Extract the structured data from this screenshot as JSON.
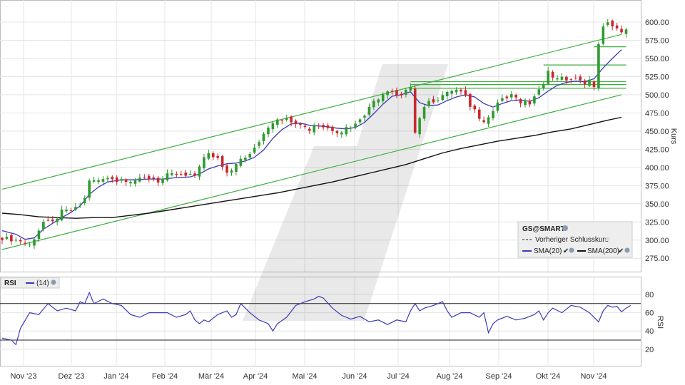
{
  "chart_data": {
    "type": "candlestick",
    "price_panel": {
      "ylabel": "Kurs",
      "ylim": [
        255,
        615
      ],
      "yticks": [
        "600.00",
        "575.00",
        "550.00",
        "525.00",
        "500.00",
        "475.00",
        "450.00",
        "425.00",
        "400.00",
        "375.00",
        "350.00",
        "325.00",
        "300.00",
        "275.00"
      ],
      "ytick_values": [
        600,
        575,
        550,
        525,
        500,
        475,
        450,
        425,
        400,
        375,
        350,
        325,
        300,
        275
      ],
      "x_ticks": [
        "Nov '23",
        "Dez '23",
        "Jan '24",
        "Feb '24",
        "Mär '24",
        "Apr '24",
        "Mai '24",
        "Jun '24",
        "Jul '24",
        "Aug '24",
        "Sep '24",
        "Okt '24",
        "Nov '24"
      ],
      "legend": {
        "symbol": "GS@SMART",
        "items": [
          "Vorheriger Schlusskurs",
          "SMA(20)",
          "SMA(200)"
        ]
      },
      "series": {
        "close_path": [
          [
            0,
            303
          ],
          [
            4,
            299
          ],
          [
            6,
            293
          ],
          [
            7,
            303
          ],
          [
            9,
            325
          ],
          [
            11,
            324
          ],
          [
            13,
            339
          ],
          [
            15,
            341
          ],
          [
            16,
            343
          ],
          [
            17,
            349
          ],
          [
            18,
            357
          ],
          [
            19,
            383
          ],
          [
            20,
            381
          ],
          [
            22,
            383
          ],
          [
            23,
            386
          ],
          [
            24,
            386
          ],
          [
            25,
            381
          ],
          [
            26,
            384
          ],
          [
            28,
            382
          ],
          [
            30,
            383
          ],
          [
            31,
            385
          ],
          [
            33,
            385
          ],
          [
            34,
            381
          ],
          [
            35,
            384
          ],
          [
            36,
            389
          ],
          [
            38,
            390
          ],
          [
            40,
            388
          ],
          [
            42,
            389
          ],
          [
            43,
            403
          ],
          [
            44,
            413
          ],
          [
            45,
            418
          ],
          [
            47,
            413
          ],
          [
            48,
            403
          ],
          [
            49,
            395
          ],
          [
            50,
            397
          ],
          [
            51,
            407
          ],
          [
            53,
            413
          ],
          [
            55,
            425
          ],
          [
            56,
            435
          ],
          [
            57,
            448
          ],
          [
            58,
            456
          ],
          [
            59,
            463
          ],
          [
            60,
            468
          ],
          [
            61,
            467
          ],
          [
            63,
            465
          ],
          [
            64,
            462
          ],
          [
            65,
            461
          ],
          [
            66,
            455
          ],
          [
            67,
            452
          ],
          [
            68,
            459
          ],
          [
            69,
            458
          ],
          [
            70,
            456
          ],
          [
            72,
            452
          ],
          [
            73,
            450
          ],
          [
            74,
            450
          ],
          [
            75,
            455
          ],
          [
            77,
            459
          ],
          [
            78,
            468
          ],
          [
            79,
            474
          ],
          [
            80,
            482
          ],
          [
            81,
            492
          ],
          [
            82,
            496
          ],
          [
            83,
            502
          ],
          [
            84,
            507
          ],
          [
            85,
            505
          ],
          [
            86,
            499
          ],
          [
            87,
            500
          ],
          [
            88,
            507
          ],
          [
            89,
            508
          ],
          [
            90,
            446
          ],
          [
            91,
            470
          ],
          [
            92,
            483
          ],
          [
            93,
            490
          ],
          [
            94,
            488
          ],
          [
            95,
            491
          ],
          [
            96,
            497
          ],
          [
            97,
            506
          ],
          [
            98,
            508
          ],
          [
            100,
            506
          ],
          [
            101,
            496
          ],
          [
            102,
            486
          ],
          [
            103,
            482
          ],
          [
            104,
            467
          ],
          [
            105,
            460
          ],
          [
            106,
            470
          ],
          [
            107,
            477
          ],
          [
            108,
            488
          ],
          [
            110,
            497
          ],
          [
            111,
            500
          ],
          [
            112,
            499
          ],
          [
            113,
            491
          ],
          [
            114,
            492
          ],
          [
            115,
            487
          ],
          [
            116,
            498
          ],
          [
            117,
            505
          ],
          [
            118,
            515
          ],
          [
            119,
            530
          ],
          [
            120,
            525
          ],
          [
            121,
            521
          ],
          [
            122,
            522
          ],
          [
            123,
            522
          ],
          [
            124,
            524
          ],
          [
            125,
            522
          ],
          [
            126,
            521
          ],
          [
            127,
            516
          ],
          [
            128,
            518
          ],
          [
            129,
            512
          ],
          [
            130,
            570
          ],
          [
            131,
            592
          ],
          [
            132,
            598
          ],
          [
            133,
            597
          ],
          [
            134,
            591
          ],
          [
            135,
            584
          ],
          [
            136,
            592
          ]
        ],
        "sma20_path": [
          [
            0,
            313
          ],
          [
            3,
            308
          ],
          [
            5,
            301
          ],
          [
            7,
            303
          ],
          [
            9,
            315
          ],
          [
            11,
            323
          ],
          [
            13,
            331
          ],
          [
            15,
            338
          ],
          [
            17,
            347
          ],
          [
            19,
            363
          ],
          [
            21,
            373
          ],
          [
            23,
            380
          ],
          [
            26,
            383
          ],
          [
            29,
            383
          ],
          [
            32,
            384
          ],
          [
            35,
            384
          ],
          [
            38,
            386
          ],
          [
            41,
            387
          ],
          [
            43,
            391
          ],
          [
            45,
            398
          ],
          [
            47,
            402
          ],
          [
            49,
            405
          ],
          [
            51,
            406
          ],
          [
            53,
            409
          ],
          [
            55,
            414
          ],
          [
            57,
            424
          ],
          [
            59,
            440
          ],
          [
            61,
            452
          ],
          [
            63,
            460
          ],
          [
            65,
            461
          ],
          [
            67,
            458
          ],
          [
            69,
            457
          ],
          [
            71,
            456
          ],
          [
            73,
            454
          ],
          [
            75,
            453
          ],
          [
            77,
            455
          ],
          [
            79,
            462
          ],
          [
            81,
            474
          ],
          [
            83,
            487
          ],
          [
            85,
            498
          ],
          [
            87,
            500
          ],
          [
            89,
            504
          ],
          [
            91,
            489
          ],
          [
            93,
            485
          ],
          [
            95,
            486
          ],
          [
            97,
            492
          ],
          [
            99,
            497
          ],
          [
            101,
            500
          ],
          [
            103,
            497
          ],
          [
            105,
            488
          ],
          [
            107,
            483
          ],
          [
            109,
            488
          ],
          [
            111,
            492
          ],
          [
            113,
            493
          ],
          [
            115,
            491
          ],
          [
            117,
            496
          ],
          [
            119,
            505
          ],
          [
            121,
            513
          ],
          [
            123,
            517
          ],
          [
            125,
            519
          ],
          [
            127,
            518
          ],
          [
            129,
            522
          ],
          [
            131,
            537
          ],
          [
            133,
            550
          ],
          [
            135,
            562
          ]
        ],
        "sma200_path": [
          [
            0,
            337
          ],
          [
            4,
            335
          ],
          [
            8,
            332
          ],
          [
            12,
            331
          ],
          [
            16,
            330
          ],
          [
            20,
            331
          ],
          [
            24,
            331
          ],
          [
            28,
            334
          ],
          [
            32,
            337
          ],
          [
            36,
            341
          ],
          [
            40,
            345
          ],
          [
            44,
            349
          ],
          [
            48,
            353
          ],
          [
            52,
            357
          ],
          [
            56,
            361
          ],
          [
            60,
            365
          ],
          [
            64,
            370
          ],
          [
            68,
            375
          ],
          [
            72,
            380
          ],
          [
            76,
            386
          ],
          [
            80,
            392
          ],
          [
            84,
            398
          ],
          [
            88,
            404
          ],
          [
            92,
            412
          ],
          [
            96,
            420
          ],
          [
            100,
            426
          ],
          [
            104,
            431
          ],
          [
            108,
            436
          ],
          [
            112,
            440
          ],
          [
            116,
            444
          ],
          [
            120,
            449
          ],
          [
            124,
            453
          ],
          [
            128,
            459
          ],
          [
            132,
            465
          ],
          [
            135,
            469
          ]
        ],
        "channel_upper": [
          [
            0,
            370
          ],
          [
            135,
            583
          ]
        ],
        "channel_mid": [
          [
            0,
            287
          ],
          [
            135,
            500
          ]
        ],
        "resistance_lines": [
          {
            "from": 89,
            "to": 136,
            "y": 514
          },
          {
            "from": 89,
            "to": 136,
            "y": 518
          },
          {
            "from": 89,
            "to": 136,
            "y": 509
          },
          {
            "from": 118,
            "to": 136,
            "y": 541
          },
          {
            "from": 129,
            "to": 136,
            "y": 566
          }
        ]
      }
    },
    "rsi_panel": {
      "label": "RSI",
      "period_label": "(14)",
      "ylabel": "RSI",
      "ylim": [
        8,
        88
      ],
      "yticks": [
        "80",
        "60",
        "40",
        "20"
      ],
      "ytick_values": [
        80,
        60,
        40,
        20
      ],
      "levels": [
        70,
        30
      ],
      "rsi_path": [
        [
          0,
          32
        ],
        [
          2,
          30
        ],
        [
          3,
          25
        ],
        [
          4,
          43
        ],
        [
          6,
          60
        ],
        [
          8,
          58
        ],
        [
          10,
          70
        ],
        [
          12,
          62
        ],
        [
          14,
          65
        ],
        [
          16,
          62
        ],
        [
          17,
          72
        ],
        [
          18,
          70
        ],
        [
          19,
          82
        ],
        [
          20,
          70
        ],
        [
          22,
          75
        ],
        [
          24,
          70
        ],
        [
          26,
          68
        ],
        [
          28,
          58
        ],
        [
          30,
          55
        ],
        [
          32,
          60
        ],
        [
          34,
          60
        ],
        [
          36,
          60
        ],
        [
          38,
          55
        ],
        [
          40,
          58
        ],
        [
          41,
          62
        ],
        [
          42,
          52
        ],
        [
          43,
          48
        ],
        [
          44,
          52
        ],
        [
          45,
          50
        ],
        [
          47,
          58
        ],
        [
          49,
          62
        ],
        [
          50,
          55
        ],
        [
          51,
          58
        ],
        [
          52,
          70
        ],
        [
          53,
          65
        ],
        [
          54,
          60
        ],
        [
          56,
          52
        ],
        [
          58,
          48
        ],
        [
          59,
          40
        ],
        [
          60,
          48
        ],
        [
          62,
          55
        ],
        [
          64,
          68
        ],
        [
          66,
          72
        ],
        [
          68,
          75
        ],
        [
          69,
          78
        ],
        [
          70,
          76
        ],
        [
          72,
          65
        ],
        [
          74,
          57
        ],
        [
          76,
          53
        ],
        [
          78,
          56
        ],
        [
          80,
          50
        ],
        [
          82,
          52
        ],
        [
          84,
          47
        ],
        [
          86,
          52
        ],
        [
          88,
          50
        ],
        [
          89,
          62
        ],
        [
          90,
          70
        ],
        [
          91,
          62
        ],
        [
          92,
          65
        ],
        [
          94,
          68
        ],
        [
          96,
          72
        ],
        [
          97,
          62
        ],
        [
          98,
          55
        ],
        [
          100,
          60
        ],
        [
          102,
          60
        ],
        [
          104,
          55
        ],
        [
          105,
          60
        ],
        [
          106,
          38
        ],
        [
          107,
          48
        ],
        [
          108,
          52
        ],
        [
          110,
          56
        ],
        [
          112,
          52
        ],
        [
          114,
          54
        ],
        [
          116,
          58
        ],
        [
          117,
          62
        ],
        [
          118,
          52
        ],
        [
          119,
          60
        ],
        [
          120,
          65
        ],
        [
          122,
          60
        ],
        [
          124,
          68
        ],
        [
          126,
          66
        ],
        [
          128,
          60
        ],
        [
          130,
          50
        ],
        [
          131,
          62
        ],
        [
          132,
          68
        ],
        [
          133,
          66
        ],
        [
          134,
          67
        ],
        [
          135,
          61
        ],
        [
          136,
          65
        ],
        [
          137,
          68
        ]
      ]
    }
  }
}
